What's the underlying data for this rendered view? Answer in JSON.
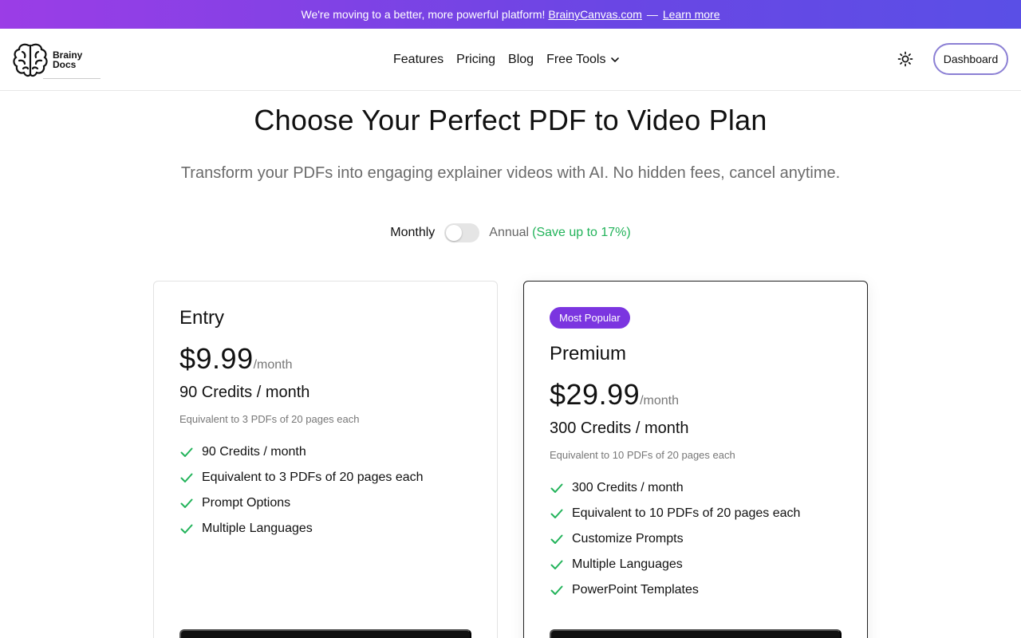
{
  "banner": {
    "text": "We're moving to a better, more powerful platform!",
    "link_text": "BrainyCanvas.com",
    "separator": "—",
    "learn_more": "Learn more"
  },
  "header": {
    "logo_text_line1": "Brainy",
    "logo_text_line2": "Docs",
    "nav": {
      "features": "Features",
      "pricing": "Pricing",
      "blog": "Blog",
      "free_tools": "Free Tools"
    },
    "theme_icon": "sun-icon",
    "dashboard": "Dashboard"
  },
  "hero": {
    "title": "Choose Your Perfect PDF to Video Plan",
    "subtitle": "Transform your PDFs into engaging explainer videos with AI. No hidden fees, cancel anytime."
  },
  "billing": {
    "monthly_label": "Monthly",
    "annual_label": "Annual",
    "save_label": "(Save up to 17%)",
    "annual_selected": false
  },
  "plans": [
    {
      "name": "Entry",
      "price": "$9.99",
      "period": "/month",
      "credits": "90 Credits / month",
      "equivalent": "Equivalent to 3 PDFs of 20 pages each",
      "features": [
        "90 Credits / month",
        "Equivalent to 3 PDFs of 20 pages each",
        "Prompt Options",
        "Multiple Languages"
      ]
    },
    {
      "badge": "Most Popular",
      "name": "Premium",
      "price": "$29.99",
      "period": "/month",
      "credits": "300 Credits / month",
      "equivalent": "Equivalent to 10 PDFs of 20 pages each",
      "features": [
        "300 Credits / month",
        "Equivalent to 10 PDFs of 20 pages each",
        "Customize Prompts",
        "Multiple Languages",
        "PowerPoint Templates"
      ]
    }
  ],
  "colors": {
    "banner_start": "#9b3de6",
    "banner_end": "#5a4fe6",
    "badge": "#7b35e0",
    "check": "#22b35a",
    "save_text": "#22b35a"
  }
}
